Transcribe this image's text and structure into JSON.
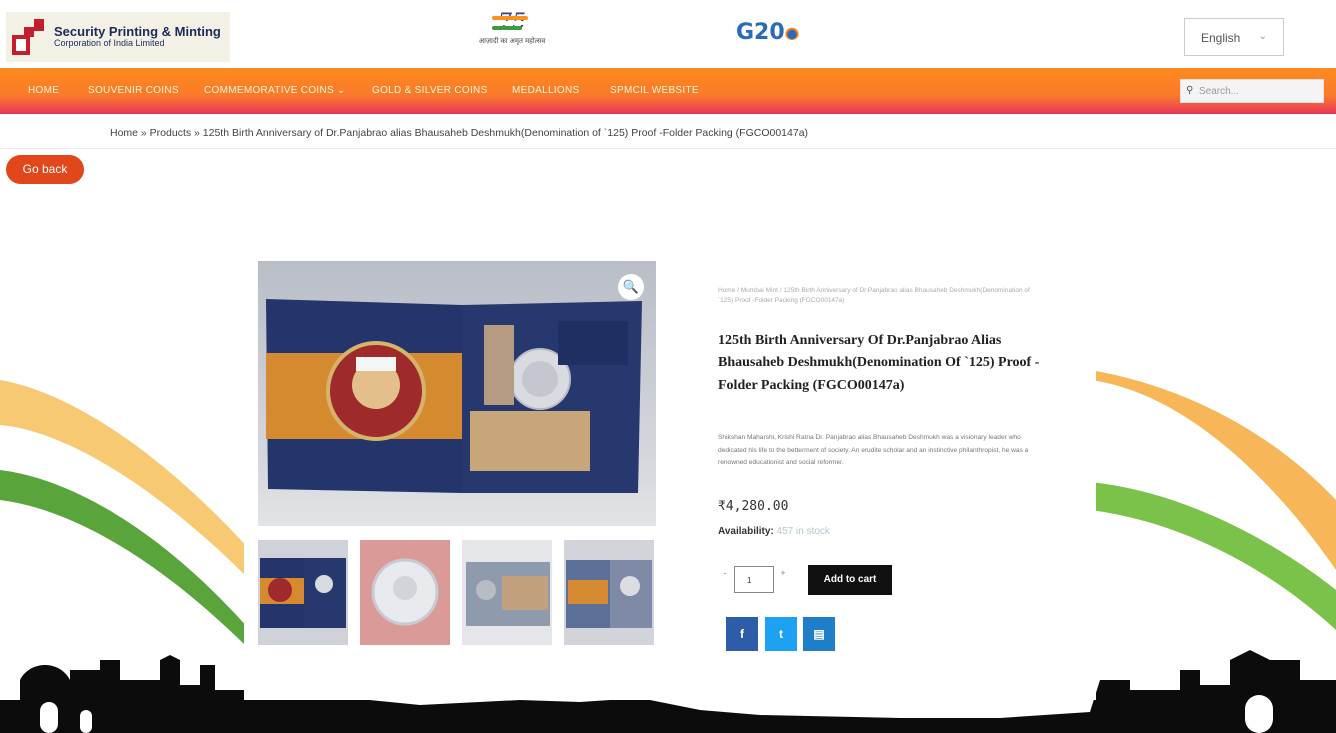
{
  "header": {
    "logo": {
      "line1": "Security Printing & Minting",
      "line2": "Corporation of India Limited"
    },
    "azadi_logo": {
      "numeral": "75",
      "subtitle": "आज़ादी का अमृत महोत्सव"
    },
    "g20_logo": {
      "text": "G20"
    },
    "language": {
      "selected": "English",
      "caret": "⌄"
    }
  },
  "nav": {
    "items": [
      {
        "label": "HOME"
      },
      {
        "label": "SOUVENIR COINS"
      },
      {
        "label": "COMMEMORATIVE COINS ⌄"
      },
      {
        "label": "GOLD & SILVER COINS"
      },
      {
        "label": "MEDALLIONS"
      },
      {
        "label": "SPMCIL WEBSITE"
      }
    ],
    "search": {
      "icon": "search-icon",
      "placeholder": "Search..."
    }
  },
  "breadcrumb": {
    "text": "Home » Products » 125th Birth Anniversary of Dr.Panjabrao alias Bhausaheb Deshmukh(Denomination of `125) Proof -Folder Packing (FGCO00147a)"
  },
  "go_back": {
    "label": "Go back"
  },
  "gallery": {
    "zoom_icon": "🔍",
    "thumbnails": [
      {
        "name": "folder front"
      },
      {
        "name": "coin"
      },
      {
        "name": "folder inner"
      },
      {
        "name": "folder open"
      }
    ]
  },
  "product": {
    "breadcrumb": "Home / Mumbai Mint / 125th Birth Anniversary of Dr.Panjabrao alias Bhausaheb Deshmukh(Denomination of `125) Proof -Folder Packing (FGCO00147a)",
    "title": "125th Birth Anniversary Of Dr.Panjabrao Alias Bhausaheb Deshmukh(Denomination Of `125) Proof -Folder Packing (FGCO00147a)",
    "description": "Shikshan Maharshi, Krishi Ratna Dr. Panjabrao alias Bhausaheb Deshmukh was a visionary leader who dedicated his life to the betterment of society. An erudite scholar and an instinctive philanthropist, he was a renowned educationist and social reformer.",
    "price": "₹4,280.00",
    "availability_label": "Availability:",
    "availability_value": "457 in stock",
    "qty_minus": "-",
    "qty_value": "1",
    "qty_plus": "+",
    "add_to_cart": "Add to cart"
  },
  "share": {
    "facebook": "f",
    "twitter": "t",
    "print": "▤"
  },
  "colors": {
    "nav_orange": "#f97a2a",
    "nav_pink": "#e9365c",
    "go_back": "#e2461b",
    "share_facebook": "#2d5da8",
    "share_twitter": "#1da1f2",
    "share_print": "#1e7ec8"
  }
}
